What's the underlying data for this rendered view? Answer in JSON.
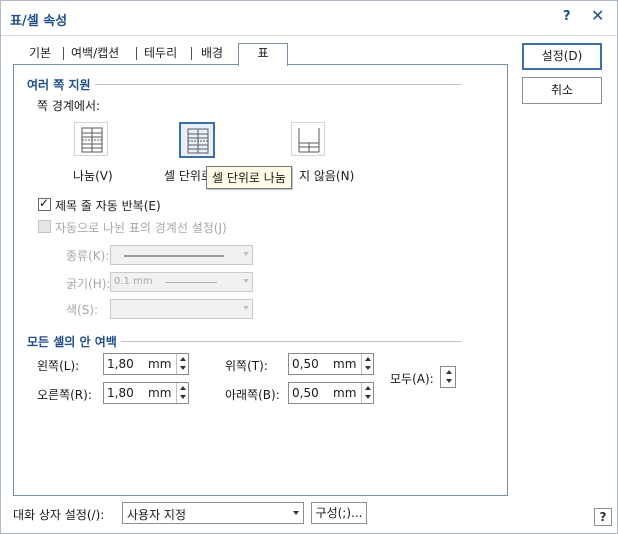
{
  "window": {
    "title": "표/셀 속성",
    "help_glyph": "?",
    "close_glyph": "✕"
  },
  "tabs": [
    {
      "label": "기본",
      "active": false
    },
    {
      "label": "여백/캡션",
      "active": false
    },
    {
      "label": "테두리",
      "active": false
    },
    {
      "label": "배경",
      "active": false
    },
    {
      "label": "표",
      "active": true
    }
  ],
  "split": {
    "section_title": "여러 쪽 지원",
    "boundary_label": "쪽 경계에서:",
    "options": [
      {
        "label": "나눔(V)",
        "selected": false,
        "icon": "split-table-icon"
      },
      {
        "label": "셀 단위로",
        "selected": true,
        "icon": "split-by-cell-icon"
      },
      {
        "label": "지 않음(N)",
        "selected": false,
        "icon": "no-split-table-icon"
      }
    ],
    "tooltip": "셀 단위로 나눔",
    "repeat_title": {
      "label": "제목 줄 자동 반복(E)",
      "checked": true
    },
    "auto_border": {
      "label": "자동으로 나뉜 표의 경계선 설정(J)",
      "checked": false,
      "enabled": false
    },
    "line_type_label": "종류(K):",
    "thickness_label": "굵기(H):",
    "thickness_value": "0.1 mm",
    "color_label": "색(S):"
  },
  "margins": {
    "section_title": "모든 셀의 안 여백",
    "left": {
      "label": "왼쪽(L):",
      "value": "1,80",
      "unit": "mm"
    },
    "right": {
      "label": "오른쪽(R):",
      "value": "1,80",
      "unit": "mm"
    },
    "top": {
      "label": "위쪽(T):",
      "value": "0,50",
      "unit": "mm"
    },
    "bottom": {
      "label": "아래쪽(B):",
      "value": "0,50",
      "unit": "mm"
    },
    "all_label": "모두(A):"
  },
  "buttons": {
    "ok": "설정(D)",
    "cancel": "취소"
  },
  "footer": {
    "dialog_setting_label": "대화 상자 설정(/):",
    "dialog_setting_value": "사용자 지정",
    "configure_button": "구성(;)...",
    "help_glyph": "?"
  },
  "colors": {
    "accent": "#1f4e8a",
    "selected_border": "#3a6fa8",
    "frame": "#7d8fa8",
    "tooltip_bg": "#fffbe7"
  }
}
